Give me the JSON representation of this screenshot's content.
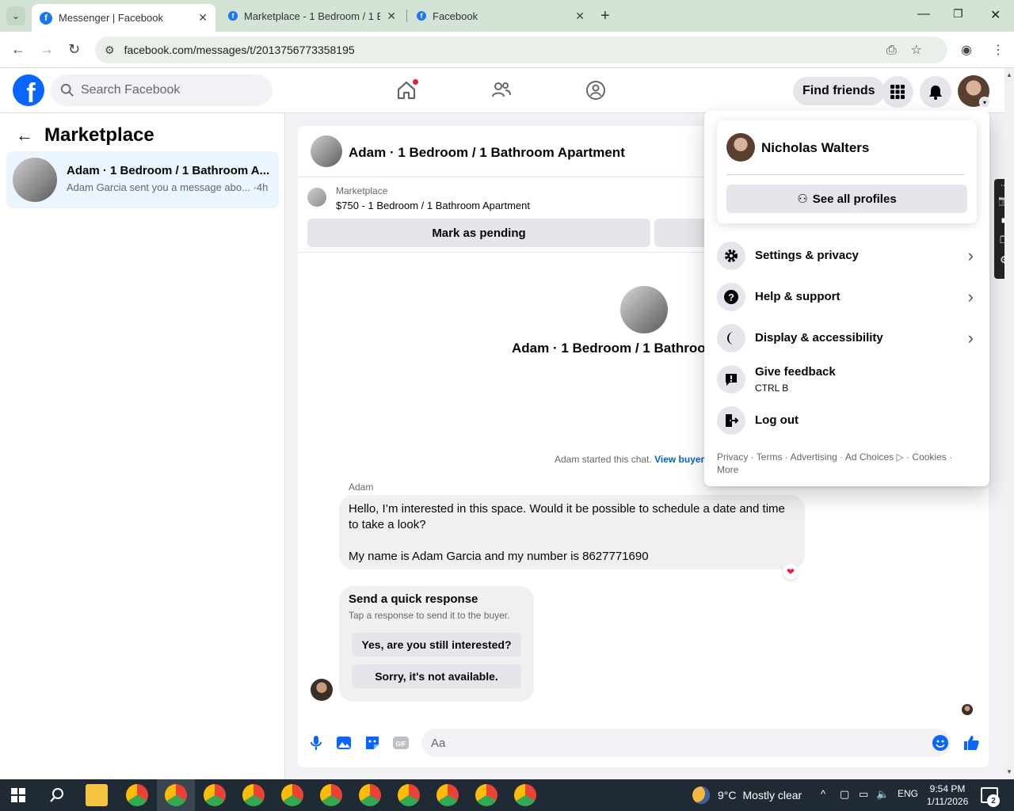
{
  "browser": {
    "tabs": [
      {
        "label": "Messenger | Facebook",
        "active": true
      },
      {
        "label": "Marketplace - 1 Bedroom / 1 Ba",
        "active": false
      },
      {
        "label": "Facebook",
        "active": false
      }
    ],
    "url": "facebook.com/messages/t/2013756773358195"
  },
  "fb_header": {
    "logo": "f",
    "search_placeholder": "Search Facebook",
    "find_friends_label": "Find friends",
    "nav_icons": [
      "home-icon",
      "friends-icon",
      "groups-icon"
    ],
    "right_icons": [
      "menu-grid-icon",
      "bell-icon"
    ]
  },
  "left_panel": {
    "title": "Marketplace",
    "conversations": [
      {
        "title": "Adam · 1 Bedroom / 1 Bathroom A...",
        "subtitle": "Adam Garcia sent you a message abo... ·4h"
      }
    ]
  },
  "chat": {
    "header_title": "Adam · 1 Bedroom / 1 Bathroom Apartment",
    "listing": {
      "category": "Marketplace",
      "title": "$750 - 1 Bedroom / 1 Bathroom Apartment",
      "mark_pending_label": "Mark as pending"
    },
    "center_title": "Adam · 1 Bedroom / 1 Bathroom",
    "started_text": "Adam started this chat.",
    "view_buyer_label": "View buyer",
    "sender_name": "Adam",
    "message_line1": "Hello, I’m interested in this space. Would it be possible to schedule a date and time",
    "message_line2": "to take a look?",
    "message_line3": "My name is Adam Garcia and my number is 8627771690",
    "reaction": "❤",
    "quick_response": {
      "title": "Send a quick response",
      "subtitle": "Tap a response to send it to the buyer.",
      "option1": "Yes, are you still interested?",
      "option2": "Sorry, it's not available."
    },
    "composer_placeholder": "Aa"
  },
  "account_menu": {
    "profile_name": "Nicholas Walters",
    "see_all_profiles_label": "See all profiles",
    "items": [
      {
        "label": "Settings & privacy",
        "icon": "gear-icon",
        "chevron": true
      },
      {
        "label": "Help & support",
        "icon": "question-icon",
        "chevron": true
      },
      {
        "label": "Display & accessibility",
        "icon": "moon-icon",
        "chevron": true
      },
      {
        "label": "Give feedback",
        "sub": "CTRL B",
        "icon": "feedback-icon",
        "chevron": false
      },
      {
        "label": "Log out",
        "icon": "logout-icon",
        "chevron": false
      }
    ],
    "footer_line1": "Privacy · Terms · Advertising · Ad Choices ▷ · Cookies ·",
    "footer_line2": "More"
  },
  "taskbar": {
    "weather_temp": "9°C",
    "weather_text": "Mostly clear",
    "language": "ENG",
    "time": "9:54 PM",
    "date": "1/11/2026",
    "notification_count": "2"
  },
  "colors": {
    "fb_blue": "#0866ff",
    "link_blue": "#0064d1",
    "chrome_green": "#d3e3d5",
    "taskbar": "#1f2a34"
  }
}
